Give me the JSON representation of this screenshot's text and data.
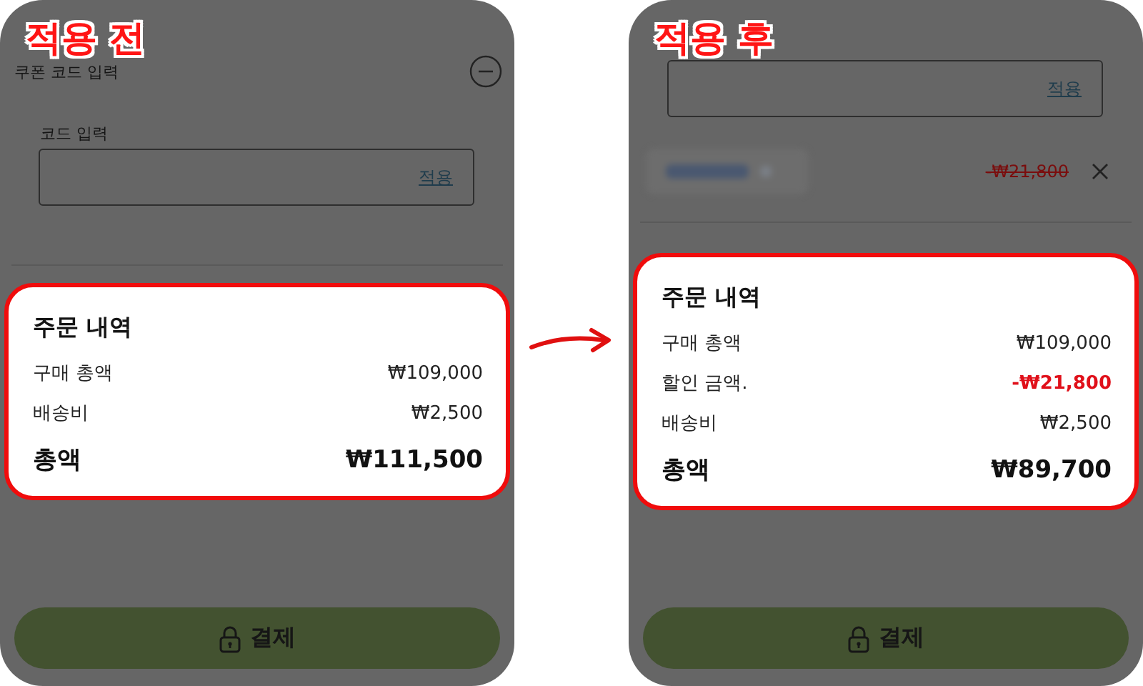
{
  "panels": [
    {
      "badge": "적용 전",
      "coupon_section": {
        "title": "쿠폰 코드 입력",
        "expanded": true
      },
      "code_field": {
        "label": "코드 입력",
        "apply": "적용"
      },
      "summary": {
        "title": "주문 내역",
        "rows": [
          {
            "kind": "normal",
            "label": "구매 총액",
            "value": "₩109,000"
          },
          {
            "kind": "normal",
            "label": "배송비",
            "value": "₩2,500"
          },
          {
            "kind": "total",
            "label": "총액",
            "value": "₩111,500"
          }
        ]
      },
      "pay_button": "결제"
    },
    {
      "badge": "적용 후",
      "code_field": {
        "apply": "적용"
      },
      "applied_coupon": {
        "discount": "-₩21,800"
      },
      "summary": {
        "title": "주문 내역",
        "rows": [
          {
            "kind": "normal",
            "label": "구매 총액",
            "value": "₩109,000"
          },
          {
            "kind": "discount",
            "label": "할인 금액.",
            "value": "-₩21,800"
          },
          {
            "kind": "normal",
            "label": "배송비",
            "value": "₩2,500"
          },
          {
            "kind": "total",
            "label": "총액",
            "value": "₩89,700"
          }
        ]
      },
      "pay_button": "결제"
    }
  ]
}
